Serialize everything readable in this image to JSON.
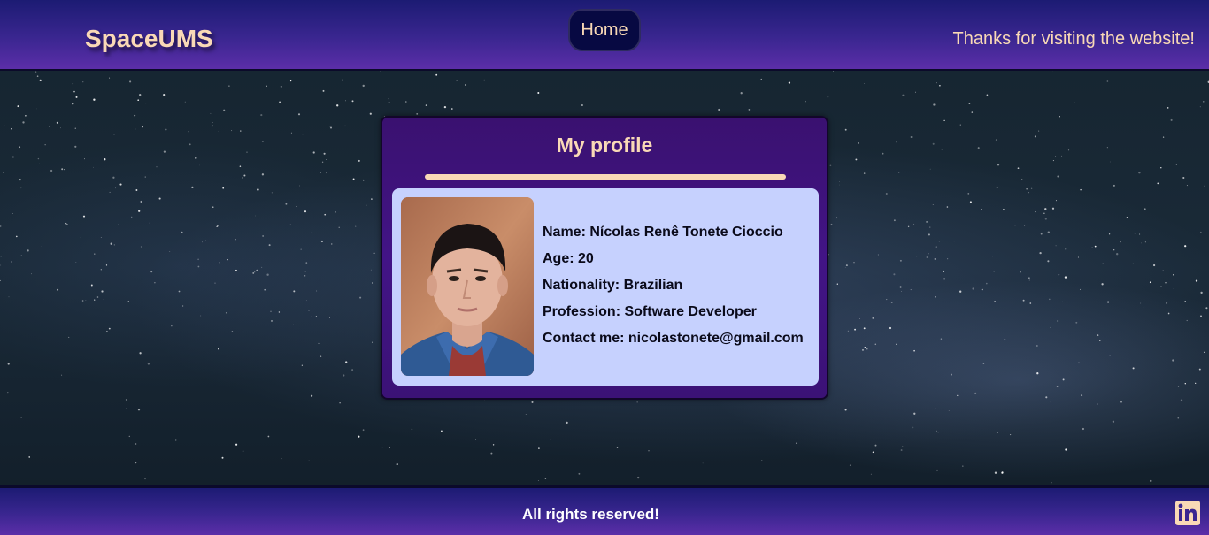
{
  "header": {
    "brand": "SpaceUMS",
    "home_label": "Home",
    "thanks_text": "Thanks for visiting the website!"
  },
  "profile": {
    "title": "My profile",
    "name_row": "Name: Nícolas Renê Tonete Cioccio",
    "age_row": "Age: 20",
    "nationality_row": "Nationality: Brazilian",
    "profession_row": "Profession: Software Developer",
    "contact_row": "Contact me: nicolastonete@gmail.com"
  },
  "footer": {
    "rights_text": "All rights reserved!",
    "social_icon": "linkedin-icon"
  },
  "colors": {
    "accent_text": "#f9d9b6",
    "header_bg": "#3a2690",
    "card_bg": "#421486",
    "panel_bg": "#c6d1fe",
    "home_button_bg": "#070942"
  }
}
